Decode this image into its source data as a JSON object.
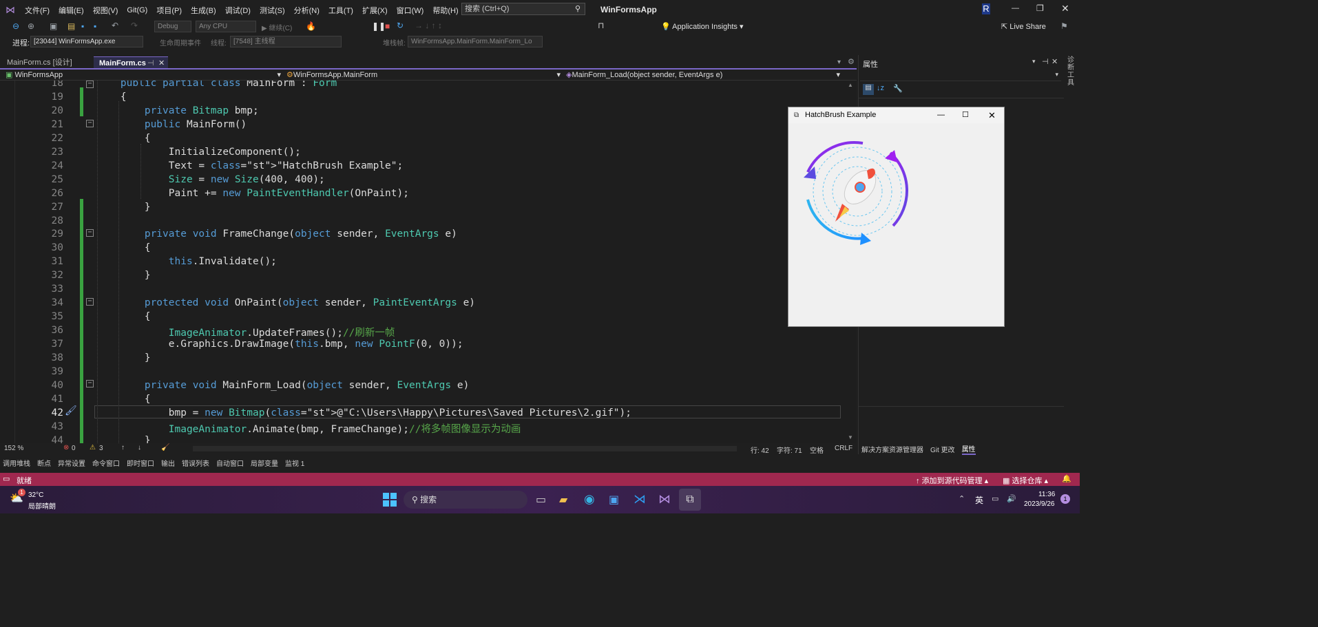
{
  "menu": [
    "文件(F)",
    "编辑(E)",
    "视图(V)",
    "Git(G)",
    "项目(P)",
    "生成(B)",
    "调试(D)",
    "测试(S)",
    "分析(N)",
    "工具(T)",
    "扩展(X)",
    "窗口(W)",
    "帮助(H)"
  ],
  "search": {
    "placeholder": "搜索 (Ctrl+Q)"
  },
  "window_title": "WinFormsApp",
  "user_initial": "R",
  "toolbar": {
    "config": "Debug",
    "platform": "Any CPU",
    "continue": "继续(C)",
    "app_insights": "Application Insights",
    "live_share": "Live Share"
  },
  "toolbar2": {
    "process_label": "进程:",
    "process": "[23044] WinFormsApp.exe",
    "lifecycle": "生命周期事件",
    "thread_label": "线程:",
    "thread": "[7548] 主线程",
    "stack_label": "堆栈帧:",
    "stack": "WinFormsApp.MainForm.MainForm_Lo"
  },
  "tabs": [
    "MainForm.cs [设计]",
    "MainForm.cs"
  ],
  "navbar": {
    "project": "WinFormsApp",
    "class": "WinFormsApp.MainForm",
    "member": "MainForm_Load(object sender, EventArgs e)"
  },
  "code_lines": [
    {
      "n": "18",
      "t": "    public partial class MainForm : Form"
    },
    {
      "n": "19",
      "t": "    {"
    },
    {
      "n": "20",
      "t": "        private Bitmap bmp;"
    },
    {
      "n": "21",
      "t": "        public MainForm()"
    },
    {
      "n": "22",
      "t": "        {"
    },
    {
      "n": "23",
      "t": "            InitializeComponent();"
    },
    {
      "n": "24",
      "t": "            Text = \"HatchBrush Example\";"
    },
    {
      "n": "25",
      "t": "            Size = new Size(400, 400);"
    },
    {
      "n": "26",
      "t": "            Paint += new PaintEventHandler(OnPaint);"
    },
    {
      "n": "27",
      "t": "        }"
    },
    {
      "n": "28",
      "t": ""
    },
    {
      "n": "29",
      "t": "        private void FrameChange(object sender, EventArgs e)"
    },
    {
      "n": "30",
      "t": "        {"
    },
    {
      "n": "31",
      "t": "            this.Invalidate();"
    },
    {
      "n": "32",
      "t": "        }"
    },
    {
      "n": "33",
      "t": ""
    },
    {
      "n": "34",
      "t": "        protected void OnPaint(object sender, PaintEventArgs e)"
    },
    {
      "n": "35",
      "t": "        {"
    },
    {
      "n": "36",
      "t": "            ImageAnimator.UpdateFrames();//刷新一帧"
    },
    {
      "n": "37",
      "t": "            e.Graphics.DrawImage(this.bmp, new PointF(0, 0));"
    },
    {
      "n": "38",
      "t": "        }"
    },
    {
      "n": "39",
      "t": ""
    },
    {
      "n": "40",
      "t": "        private void MainForm_Load(object sender, EventArgs e)"
    },
    {
      "n": "41",
      "t": "        {"
    },
    {
      "n": "42",
      "t": "            bmp = new Bitmap(@\"C:\\Users\\Happy\\Pictures\\Saved Pictures\\2.gif\");"
    },
    {
      "n": "43",
      "t": "            ImageAnimator.Animate(bmp, FrameChange);//将多帧图像显示为动画"
    },
    {
      "n": "44",
      "t": "        }"
    }
  ],
  "editor_status": {
    "zoom": "152 %",
    "errors": "0",
    "warnings": "3",
    "line": "行: 42",
    "char": "字符: 71",
    "space": "空格",
    "eol": "CRLF"
  },
  "right_tabs": [
    "解决方案资源管理器",
    "Git 更改",
    "属性"
  ],
  "props_title": "属性",
  "toolbox_vertical": "诊断工具",
  "bottom_tabs": [
    "调用堆栈",
    "断点",
    "异常设置",
    "命令窗口",
    "即时窗口",
    "输出",
    "错误列表",
    "自动窗口",
    "局部变量",
    "监视 1"
  ],
  "status": {
    "ready": "就绪",
    "source_control": "添加到源代码管理",
    "repo": "选择仓库"
  },
  "form": {
    "title": "HatchBrush Example"
  },
  "taskbar": {
    "temp": "32°C",
    "weather": "局部晴朗",
    "search": "搜索",
    "ime": "英",
    "time": "11:36",
    "date": "2023/9/26",
    "badge": "1",
    "notif": "1"
  }
}
